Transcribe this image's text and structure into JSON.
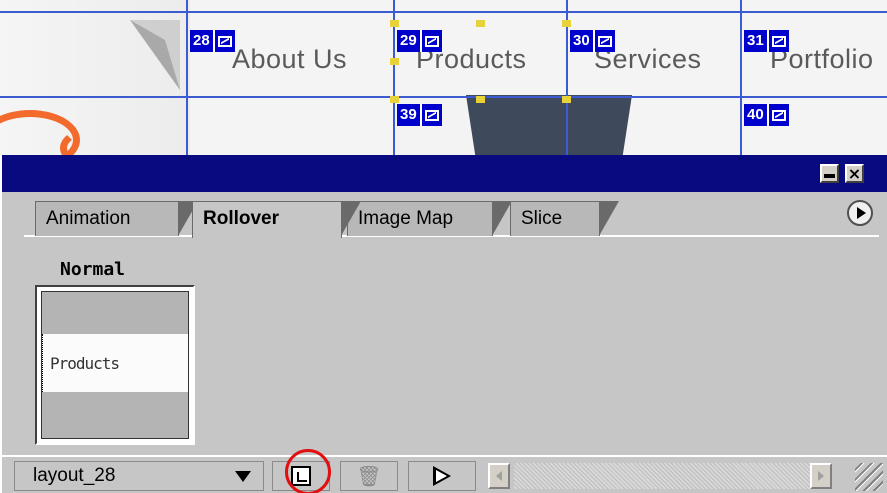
{
  "canvas": {
    "nav": [
      {
        "text": "About Us",
        "slice": "28"
      },
      {
        "text": "Products",
        "slice": "29"
      },
      {
        "text": "Services",
        "slice": "30"
      },
      {
        "text": "Portfolio",
        "slice": "31"
      }
    ],
    "lower_slices": [
      "39",
      "40"
    ]
  },
  "panel": {
    "tabs": [
      "Animation",
      "Rollover",
      "Image Map",
      "Slice"
    ],
    "active_tab": "Rollover",
    "state_label": "Normal",
    "thumbnail_text": "Products",
    "slice_select": "layout_28"
  },
  "colors": {
    "titlebar": "#0a0a80",
    "slice_badge": "#0000cc",
    "guide_line": "#3b5bd1",
    "highlight_circle": "#e01010"
  }
}
